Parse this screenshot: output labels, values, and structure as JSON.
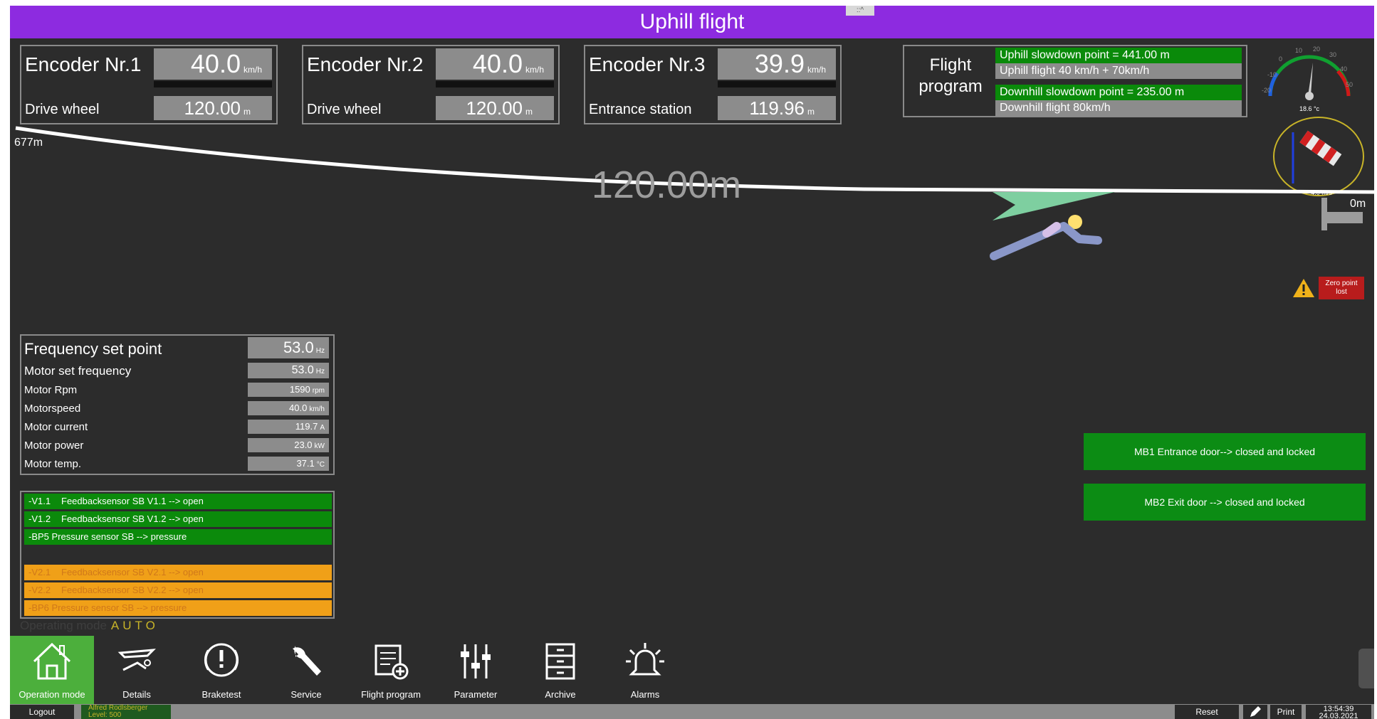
{
  "window": {
    "title": "Uphill flight",
    "handle": "::^"
  },
  "encoders": [
    {
      "name": "Encoder Nr.1",
      "speed": "40.0",
      "speed_unit": "km/h",
      "sub_label": "Drive wheel",
      "position": "120.00",
      "position_unit": "m"
    },
    {
      "name": "Encoder Nr.2",
      "speed": "40.0",
      "speed_unit": "km/h",
      "sub_label": "Drive wheel",
      "position": "120.00",
      "position_unit": "m"
    },
    {
      "name": "Encoder Nr.3",
      "speed": "39.9",
      "speed_unit": "km/h",
      "sub_label": "Entrance station",
      "position": "119.96",
      "position_unit": "m"
    }
  ],
  "flight_program": {
    "label_line1": "Flight",
    "label_line2": "program",
    "rows": [
      "Uphill slowdown point  = 441.00 m",
      "Uphill flight 40 km/h + 70km/h",
      "Downhill slowdown point  = 235.00 m",
      "Downhill flight 80km/h"
    ]
  },
  "gauge": {
    "temperature": "18.6 °c",
    "ticks": [
      "-20",
      "-10",
      "0",
      "10",
      "20",
      "30",
      "40",
      "50"
    ],
    "wind": "4.0 m/s"
  },
  "track": {
    "start_label": "677m",
    "end_label": "0m",
    "current_position": "120.00m",
    "current_fraction": 0.177
  },
  "zero_point": {
    "text_line1": "Zero point",
    "text_line2": "lost"
  },
  "motor": {
    "rows": [
      {
        "label": "Frequency set point",
        "value": "53.0",
        "unit": "Hz"
      },
      {
        "label": "Motor set frequency",
        "value": "53.0",
        "unit": "Hz"
      },
      {
        "label": "Motor Rpm",
        "value": "1590",
        "unit": "rpm"
      },
      {
        "label": "Motorspeed",
        "value": "40.0",
        "unit": "km/h"
      },
      {
        "label": "Motor current",
        "value": "119.7",
        "unit": "A"
      },
      {
        "label": "Motor power",
        "value": "23.0",
        "unit": "kW"
      },
      {
        "label": "Motor temp.",
        "value": "37.1",
        "unit": "°C"
      }
    ]
  },
  "sensors": [
    {
      "code": "-V1.1",
      "text": "Feedbacksensor SB V1.1 --> open",
      "status": "green"
    },
    {
      "code": "-V1.2",
      "text": "Feedbacksensor SB V1.2 --> open",
      "status": "green"
    },
    {
      "code": "",
      "text": "-BP5 Pressure sensor SB --> pressure",
      "status": "green"
    },
    {
      "code": "-V2.1",
      "text": "Feedbacksensor SB V2.1 --> open",
      "status": "orange"
    },
    {
      "code": "-V2.2",
      "text": "Feedbacksensor SB V2.2 --> open",
      "status": "orange"
    },
    {
      "code": "",
      "text": "-BP6 Pressure sensor SB --> pressure",
      "status": "orange"
    }
  ],
  "operating_mode": {
    "label": "Operating mode",
    "value": "AUTO"
  },
  "doors": [
    "MB1 Entrance door--> closed and locked",
    "MB2 Exit door --> closed and locked"
  ],
  "nav": [
    "Operation mode",
    "Details",
    "Braketest",
    "Service",
    "Flight program",
    "Parameter",
    "Archive",
    "Alarms"
  ],
  "statusbar": {
    "logout": "Logout",
    "user": "Alfred Rodlsberger",
    "level": "Level: 500",
    "reset": "Reset",
    "print": "Print",
    "time": "13:54:39",
    "date": "24.03.2021"
  },
  "colors": {
    "title": "#8d2be0",
    "status_ok": "#0a8a0a",
    "status_warn": "#f0a018",
    "alarm": "#b81c1c"
  }
}
